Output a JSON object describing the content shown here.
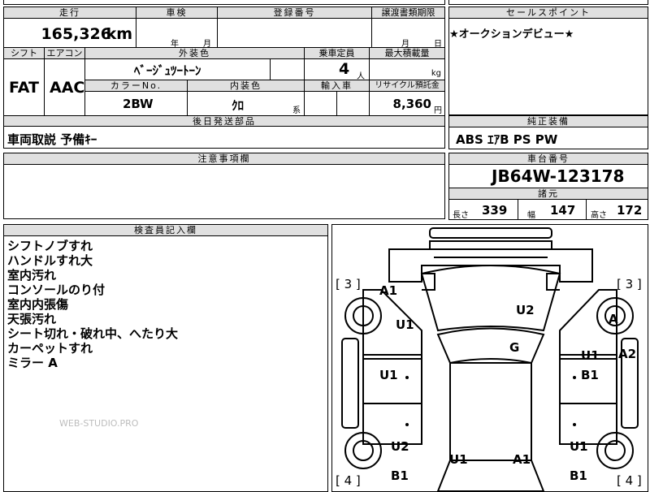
{
  "main": {
    "mileage_header": "走行",
    "mileage_value": "165,326",
    "mileage_unit": "km",
    "inspection_header": "車検",
    "inspection_year": "年",
    "inspection_month": "月",
    "registration_header": "登録番号",
    "transfer_header": "譲渡書類期限",
    "transfer_month": "月",
    "transfer_day": "日",
    "shift_header": "シフト",
    "shift_value": "FAT",
    "aircon_header": "エアコン",
    "aircon_value": "AAC",
    "exterior_header": "外装色",
    "exterior_value": "ﾍﾞｰｼﾞｭﾂｰﾄｰﾝ",
    "color_no_header": "カラーNo.",
    "color_no_value": "2BW",
    "interior_header": "内装色",
    "interior_value": "ｸﾛ",
    "interior_suffix": "系",
    "capacity_header": "乗車定員",
    "capacity_value": "4",
    "capacity_unit": "人",
    "load_header": "最大積載量",
    "load_unit": "kg",
    "import_header": "輸入車",
    "recycle_header": "リサイクル預託金",
    "recycle_value": "8,360",
    "recycle_unit": "円",
    "parts_header": "後日発送部品",
    "parts_value": "車両取説 予備ｷｰ",
    "caution_header": "注意事項欄"
  },
  "right": {
    "sales_header": "セールスポイント",
    "sales_value": "★オークションデビュー★",
    "equipment_header": "純正装備",
    "equipment_value": "ABS ｴｱB PS PW",
    "chassis_header": "車台番号",
    "chassis_value": "JB64W-123178",
    "dims_header": "諸元",
    "length_label": "長さ",
    "length_value": "339",
    "width_label": "幅",
    "width_value": "147",
    "height_label": "高さ",
    "height_value": "172"
  },
  "inspector": {
    "header": "検査員記入欄",
    "notes": [
      "シフトノブすれ",
      "ハンドルすれ大",
      "室内汚れ",
      "コンソールのり付",
      "室内内張傷",
      "天張汚れ",
      "シート切れ・破れ中、へたり大",
      "カーペットすれ",
      "ミラー A"
    ],
    "watermark": "WEB-STUDIO.PRO"
  },
  "diagram": {
    "marks": [
      {
        "id": "tl-bracket",
        "text": "[ 3 ]"
      },
      {
        "id": "tr-bracket",
        "text": "[ 3 ]"
      },
      {
        "id": "bl-bracket",
        "text": "[ 4 ]"
      },
      {
        "id": "br-bracket",
        "text": "[ 4 ]"
      },
      {
        "id": "a1-front-left",
        "text": "A1"
      },
      {
        "id": "u2-hood",
        "text": "U2"
      },
      {
        "id": "u1-left-fender",
        "text": "U1"
      },
      {
        "id": "a-right-wheel",
        "text": "A"
      },
      {
        "id": "g-windshield",
        "text": "G"
      },
      {
        "id": "u1-right-front",
        "text": "U1"
      },
      {
        "id": "a2-right-edge",
        "text": "A2"
      },
      {
        "id": "u1-left-door",
        "text": "U1"
      },
      {
        "id": "b1-right-door",
        "text": "B1"
      },
      {
        "id": "u2-left-rear",
        "text": "U2"
      },
      {
        "id": "u1-right-rear",
        "text": "U1"
      },
      {
        "id": "u1-rear-center",
        "text": "U1"
      },
      {
        "id": "a1-rear-center",
        "text": "A1"
      },
      {
        "id": "b1-left-bottom",
        "text": "B1"
      },
      {
        "id": "b1-right-bottom",
        "text": "B1"
      }
    ]
  }
}
